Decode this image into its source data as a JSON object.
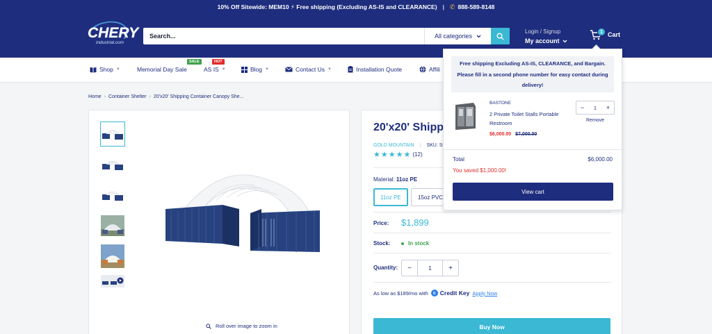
{
  "announcement": {
    "text": "10% Off Sitewide: MEM10 ⚡ Free shipping (Excluding AS-IS and CLEARANCE)",
    "separator": "|",
    "phone": "888-589-8148"
  },
  "header": {
    "logo_text": "CHERY",
    "logo_sub": "industrial.com",
    "search_placeholder": "Search...",
    "category_label": "All categories",
    "login_label": "Login / Signup",
    "account_label": "My account",
    "cart_label": "Cart",
    "cart_count": "1"
  },
  "nav": {
    "items": [
      {
        "label": "Shop"
      },
      {
        "label": "Memorial Day Sale"
      },
      {
        "label": "AS IS"
      },
      {
        "label": "Blog"
      },
      {
        "label": "Contact Us"
      },
      {
        "label": "Installation Quote"
      },
      {
        "label": "Affili"
      }
    ],
    "sale_tag": "SALE",
    "hot_tag": "HOT"
  },
  "breadcrumb": {
    "items": [
      "Home",
      "Container Shelter",
      "20'x20' Shipping Container Canopy She..."
    ]
  },
  "gallery": {
    "zoom_hint": "Roll over image to zoom in"
  },
  "product": {
    "title": "20'x20' Shippi",
    "vendor": "GOLD MOUNTAIN",
    "sku": "SKU: SC",
    "rating": 5,
    "review_count": "(12)",
    "material_label": "Material:",
    "material_value": "11oz PE",
    "swatches": [
      "11oz PE",
      "15oz PVC"
    ],
    "price_label": "Price:",
    "price": "$1,899",
    "stock_label": "Stock:",
    "stock_value": "In stock",
    "quantity_label": "Quantity:",
    "quantity": "1",
    "credit_text": "As low as $189/mo with",
    "credit_brand": "Credit Key",
    "credit_apply": "Apply Now",
    "buy_now": "Buy Now"
  },
  "cart_popup": {
    "notice": "Free shipping Excluding AS-IS, CLEARANCE, and Bargain. Please fill in a second phone number for easy contact during delivery!",
    "item": {
      "vendor": "BASTONE",
      "name": "2 Private Toilet Stalls Portable Restroom",
      "price": "$6,000.00",
      "compare_price": "$7,000.00",
      "quantity": "1",
      "remove": "Remove"
    },
    "total_label": "Total",
    "total": "$6,000.00",
    "saved": "You saved $1,000.00!",
    "view_cart": "View cart"
  },
  "colors": {
    "brand": "#1e2d7d",
    "accent": "#3ab8d4",
    "sale": "#e12b2b",
    "stock": "#3fa34d"
  }
}
